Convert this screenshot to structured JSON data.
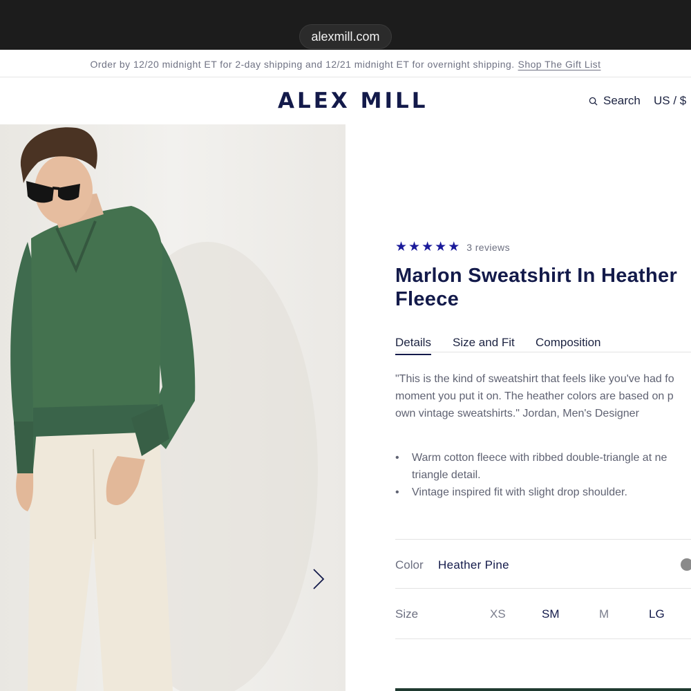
{
  "browser": {
    "url": "alexmill.com"
  },
  "promo": {
    "text": "Order by 12/20 midnight ET for 2-day shipping and 12/21 midnight ET for overnight shipping.",
    "link": "Shop The Gift List"
  },
  "header": {
    "logo": "ALEX MILL",
    "search_label": "Search",
    "locale": "US / $"
  },
  "product": {
    "rating": {
      "stars": 5,
      "reviews_text": "3 reviews"
    },
    "title": "Marlon Sweatshirt In Heather Fleece",
    "tabs": [
      {
        "label": "Details",
        "active": true
      },
      {
        "label": "Size and Fit",
        "active": false
      },
      {
        "label": "Composition",
        "active": false
      }
    ],
    "quote_lines": [
      "\"This is the kind of sweatshirt that feels like you've had fo",
      "moment you put it on. The heather colors are based on p",
      "own vintage sweatshirts.\" Jordan, Men's Designer"
    ],
    "bullets": [
      {
        "line1": "Warm cotton fleece with ribbed double-triangle at ne",
        "line2": "triangle detail."
      },
      {
        "line1": "Vintage inspired fit with slight drop shoulder.",
        "line2": ""
      }
    ],
    "color": {
      "label": "Color",
      "value": "Heather Pine",
      "swatch_color": "#8a8a8a"
    },
    "size": {
      "label": "Size",
      "options": [
        {
          "label": "XS",
          "available": false
        },
        {
          "label": "SM",
          "available": true
        },
        {
          "label": "M",
          "available": false
        },
        {
          "label": "LG",
          "available": true
        }
      ]
    }
  },
  "colors": {
    "brand_navy": "#131a4a",
    "star_blue": "#1a1a9a",
    "sweatshirt_green": "#3f6b4e"
  }
}
